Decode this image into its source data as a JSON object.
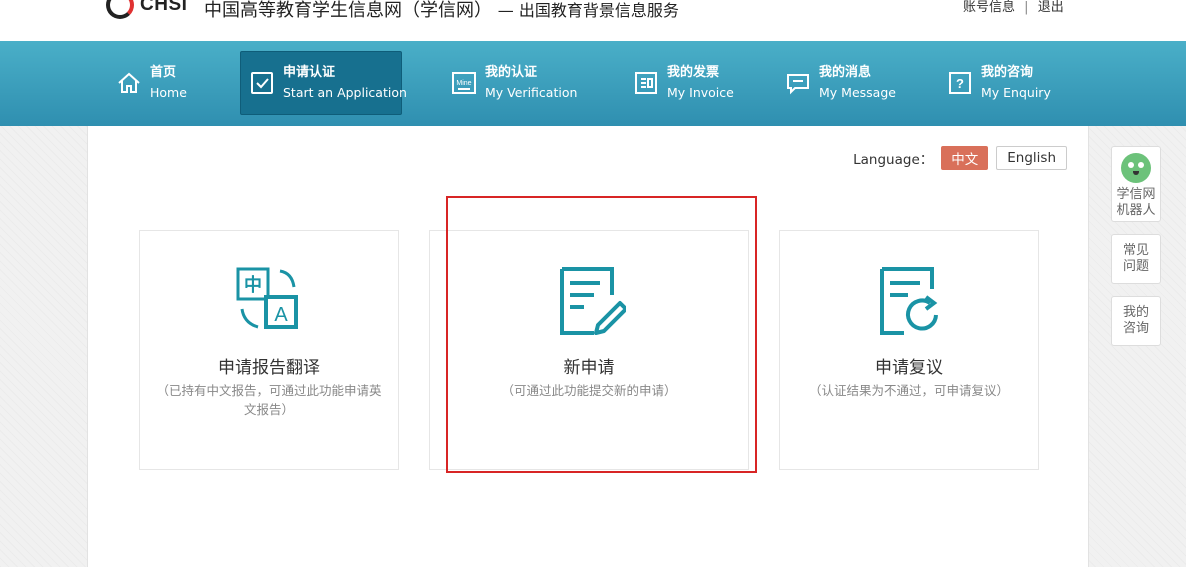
{
  "header": {
    "logo_text": "CHSI",
    "site_title": "中国高等教育学生信息网（学信网）",
    "site_subtitle": "— 出国教育背景信息服务",
    "account_link": "账号信息",
    "separator": "|",
    "logout_link": "退出"
  },
  "nav": {
    "items": [
      {
        "cn": "首页",
        "en": "Home",
        "icon": "home-icon"
      },
      {
        "cn": "申请认证",
        "en": "Start an Application",
        "icon": "checkbox-icon",
        "active": true
      },
      {
        "cn": "我的认证",
        "en": "My Verification",
        "icon": "mine-icon",
        "icon_text": "Mine"
      },
      {
        "cn": "我的发票",
        "en": "My Invoice",
        "icon": "invoice-icon"
      },
      {
        "cn": "我的消息",
        "en": "My Message",
        "icon": "message-icon"
      },
      {
        "cn": "我的咨询",
        "en": "My Enquiry",
        "icon": "enquiry-icon",
        "icon_text": "?"
      }
    ]
  },
  "language": {
    "label": "Language：",
    "options": [
      "中文",
      "English"
    ],
    "selected": "中文"
  },
  "cards": [
    {
      "title": "申请报告翻译",
      "desc": "（已持有中文报告，可通过此功能申请英文报告）",
      "icon": "translate-icon",
      "icon_text_1": "中",
      "icon_text_2": "A"
    },
    {
      "title": "新申请",
      "desc": "（可通过此功能提交新的申请）",
      "icon": "new-application-icon"
    },
    {
      "title": "申请复议",
      "desc": "（认证结果为不通过，可申请复议）",
      "icon": "review-icon"
    }
  ],
  "side": {
    "robot_line1": "学信网",
    "robot_line2": "机器人",
    "faq_line1": "常见",
    "faq_line2": "问题",
    "ask_line1": "我的",
    "ask_line2": "咨询"
  },
  "colors": {
    "nav_bg": "#3a9fbe",
    "nav_active": "#17708f",
    "icon_teal": "#1a93a5",
    "lang_active": "#d9705a",
    "highlight": "#d82525"
  }
}
